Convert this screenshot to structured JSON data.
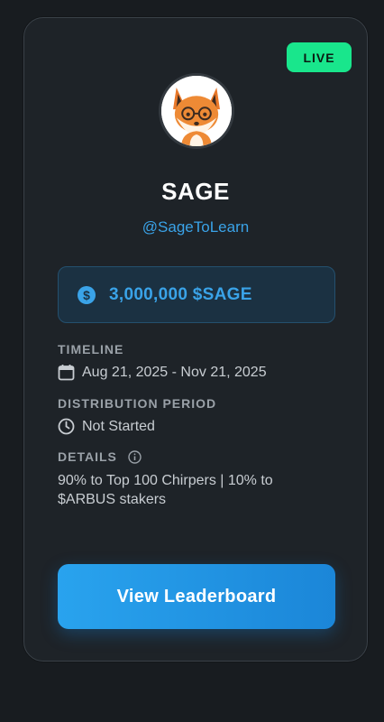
{
  "status": {
    "badge": "LIVE",
    "badge_color": "#19e68c"
  },
  "profile": {
    "name": "SAGE",
    "handle": "@SageToLearn",
    "avatar_icon": "fox-with-glasses-avatar"
  },
  "reward": {
    "amount": "3,000,000 $SAGE",
    "icon": "dollar-coin-icon",
    "accent_color": "#3aa3e8"
  },
  "timeline": {
    "label": "TIMELINE",
    "value": "Aug 21, 2025 - Nov 21, 2025",
    "icon": "calendar-icon"
  },
  "distribution": {
    "label": "DISTRIBUTION PERIOD",
    "value": "Not Started",
    "icon": "clock-icon"
  },
  "details": {
    "label": "DETAILS",
    "info_icon": "info-icon",
    "value": "90% to Top 100 Chirpers | 10% to $ARBUS stakers"
  },
  "cta": {
    "label": "View Leaderboard"
  }
}
